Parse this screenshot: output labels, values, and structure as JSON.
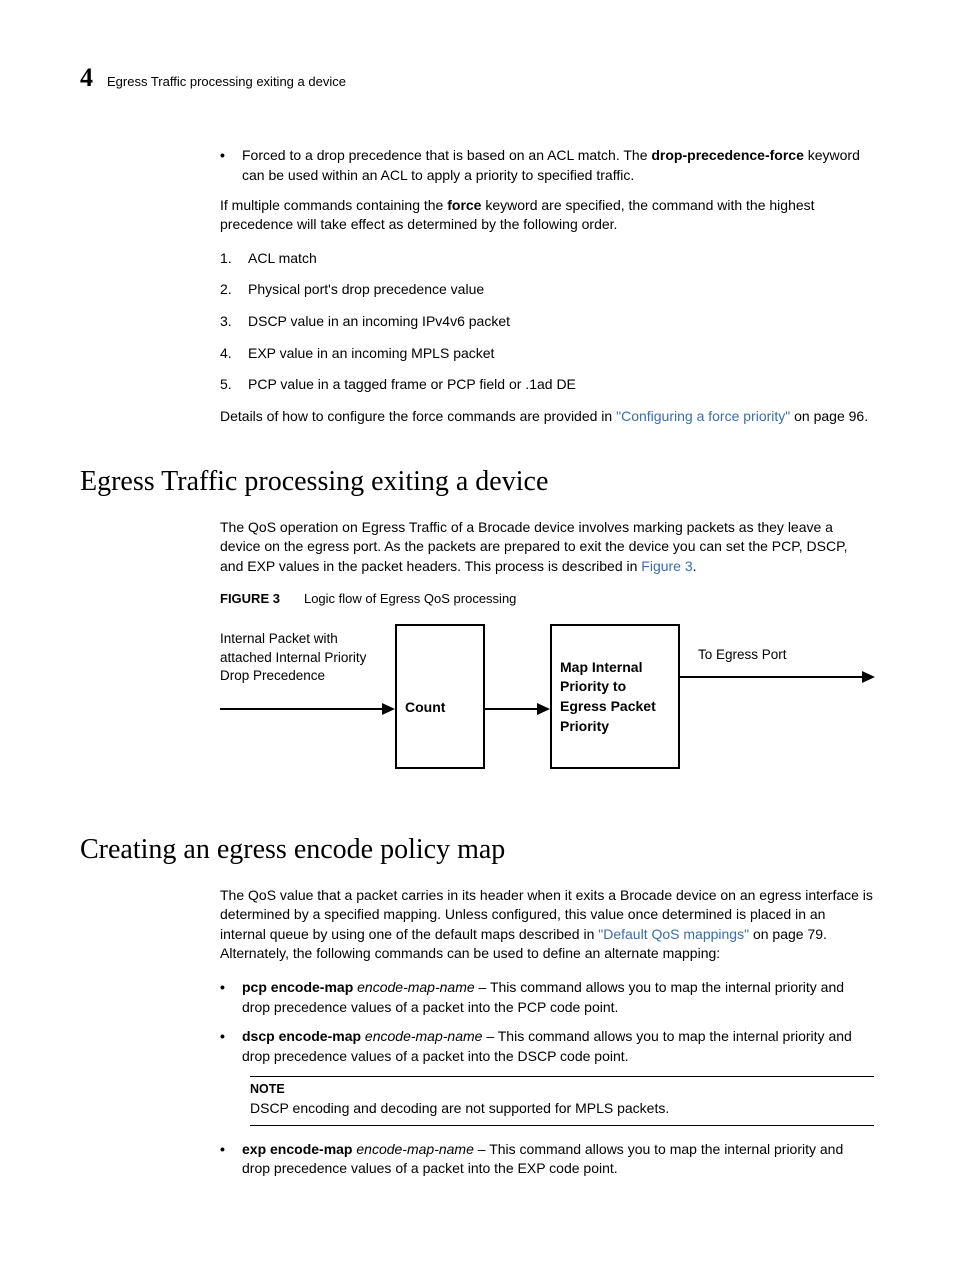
{
  "header": {
    "chapter_number": "4",
    "title": "Egress Traffic processing exiting a device"
  },
  "intro_bullet": {
    "pre": "Forced to a drop precedence that is based on an ACL match. The ",
    "bold": "drop-precedence-force",
    "post": " keyword can be used within an ACL to apply a priority to specified traffic."
  },
  "multi_cmd": {
    "pre": "If multiple commands containing the ",
    "bold": "force",
    "post": " keyword are specified, the command with the highest precedence will take effect as determined by the following order."
  },
  "ordered": [
    "ACL match",
    " Physical port's drop precedence value",
    "DSCP value in an incoming IPv4v6 packet",
    "EXP value in an incoming MPLS packet",
    "PCP value in a tagged frame or PCP field or .1ad DE"
  ],
  "details_para": {
    "pre": "Details of how to configure the force commands are provided in ",
    "link": "\"Configuring a force priority\"",
    "post": " on page 96."
  },
  "section1": {
    "title": "Egress Traffic processing exiting a device",
    "para_pre": "The QoS operation on Egress Traffic of a Brocade device involves marking packets as they leave a device on the egress port. As the packets are prepared to exit the device you can set the PCP, DSCP, and EXP values in the packet headers. This process is described in ",
    "para_link": "Figure 3",
    "para_post": ".",
    "fig_label": "FIGURE 3",
    "fig_title": "Logic flow of Egress QoS processing"
  },
  "diagram": {
    "input_label": "Internal Packet with attached Internal Priority Drop Precedence",
    "box1": "Count",
    "box2": "Map Internal Priority to Egress Packet Priority",
    "output_label": "To Egress Port"
  },
  "section2": {
    "title": "Creating an egress encode policy map",
    "para_pre": "The QoS value that a packet carries in its header when it exits a Brocade device on an egress interface is determined by a specified mapping. Unless configured, this value once determined is placed in an internal queue by using one of the default maps described in ",
    "para_link": "\"Default QoS mappings\"",
    "para_post": " on page 79. Alternately, the following commands can be used to define an alternate mapping:"
  },
  "bullets2": {
    "b1_bold": "pcp encode-map",
    "b1_ital": " encode-map-name",
    "b1_rest": " – This command allows you to map the internal priority and drop precedence values of a packet into the PCP code point.",
    "b2_bold": "dscp encode-map",
    "b2_ital": " encode-map-name",
    "b2_rest": " – This command allows you to map the internal priority and drop precedence values of a packet into the DSCP code point.",
    "b3_bold": "exp encode-map",
    "b3_ital": " encode-map-name",
    "b3_rest": " – This command allows you to map the internal priority and drop precedence values of a packet into the EXP code point."
  },
  "note": {
    "label": "NOTE",
    "text": "DSCP encoding and decoding are not supported for MPLS packets."
  }
}
